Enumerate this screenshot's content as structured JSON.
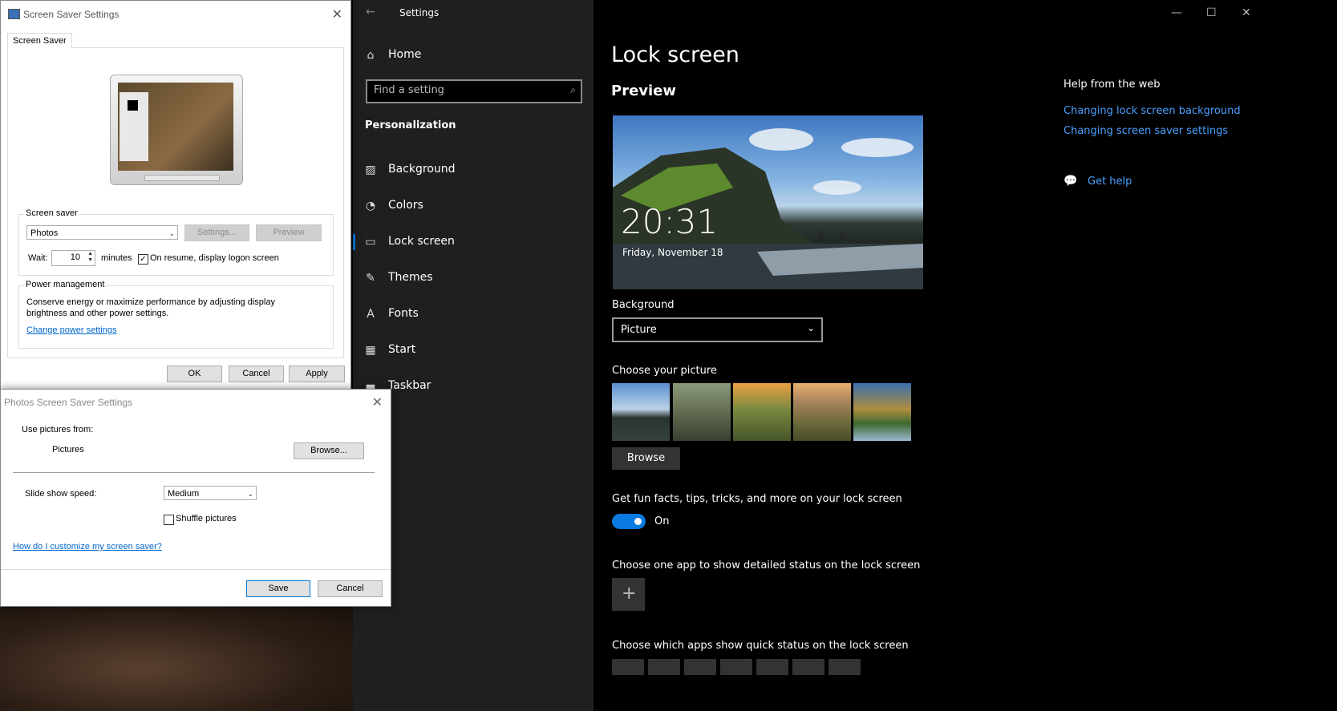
{
  "settings": {
    "title": "Settings",
    "nav": {
      "home": "Home",
      "search_placeholder": "Find a setting",
      "section": "Personalization",
      "items": [
        {
          "label": "Background"
        },
        {
          "label": "Colors"
        },
        {
          "label": "Lock screen"
        },
        {
          "label": "Themes"
        },
        {
          "label": "Fonts"
        },
        {
          "label": "Start"
        },
        {
          "label": "Taskbar"
        }
      ]
    },
    "main": {
      "title": "Lock screen",
      "preview_heading": "Preview",
      "preview_time": "20:31",
      "preview_date": "Friday, November 18",
      "background_label": "Background",
      "background_value": "Picture",
      "choose_picture_label": "Choose your picture",
      "browse_label": "Browse",
      "fun_facts_label": "Get fun facts, tips, tricks, and more on your lock screen",
      "toggle_state": "On",
      "detailed_status_label": "Choose one app to show detailed status on the lock screen",
      "quick_status_label": "Choose which apps show quick status on the lock screen"
    },
    "help": {
      "heading": "Help from the web",
      "links": [
        "Changing lock screen background",
        "Changing screen saver settings"
      ],
      "get_help": "Get help"
    }
  },
  "screensaver_dialog": {
    "title": "Screen Saver Settings",
    "tab": "Screen Saver",
    "group_label": "Screen saver",
    "selected": "Photos",
    "settings_btn": "Settings...",
    "preview_btn": "Preview",
    "wait_label": "Wait:",
    "wait_value": "10",
    "minutes_label": "minutes",
    "resume_label": "On resume, display logon screen",
    "power_group": "Power management",
    "power_text": "Conserve energy or maximize performance by adjusting display brightness and other power settings.",
    "power_link": "Change power settings",
    "ok": "OK",
    "cancel": "Cancel",
    "apply": "Apply"
  },
  "photos_dialog": {
    "title": "Photos Screen Saver Settings",
    "use_pictures_label": "Use pictures from:",
    "folder": "Pictures",
    "browse": "Browse...",
    "speed_label": "Slide show speed:",
    "speed_value": "Medium",
    "shuffle_label": "Shuffle pictures",
    "help_link": "How do I customize my screen saver?",
    "save": "Save",
    "cancel": "Cancel"
  }
}
